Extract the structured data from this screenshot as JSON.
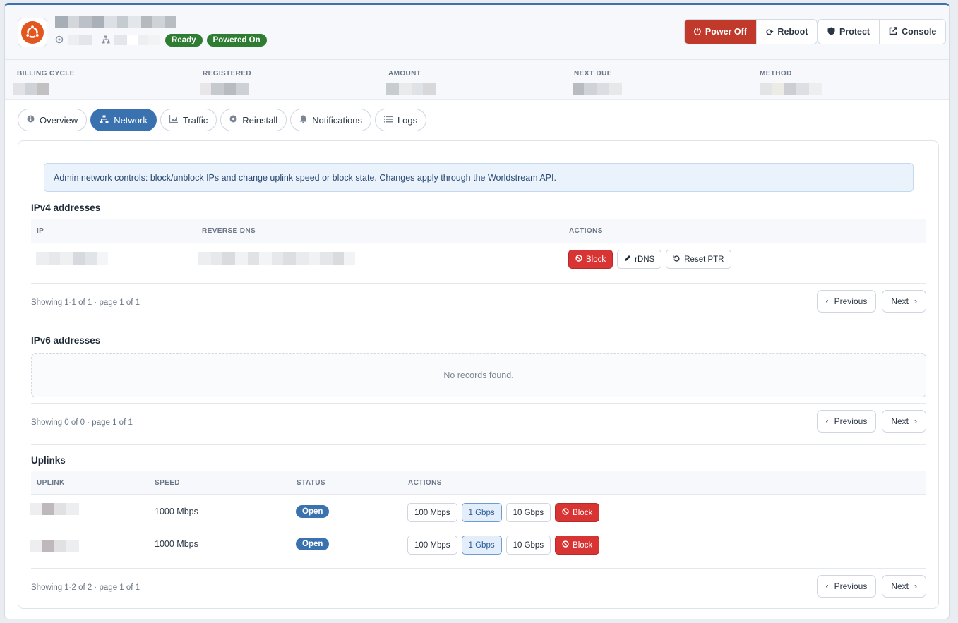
{
  "header": {
    "status_badges": [
      "Ready",
      "Powered On"
    ],
    "buttons": {
      "power_off": "Power Off",
      "reboot": "Reboot",
      "protect": "Protect",
      "console": "Console"
    },
    "os_icon": "ubuntu-logo"
  },
  "billing": {
    "labels": [
      "BILLING CYCLE",
      "REGISTERED",
      "AMOUNT",
      "NEXT DUE",
      "METHOD"
    ]
  },
  "tabs": [
    {
      "label": "Overview",
      "icon": "info-icon"
    },
    {
      "label": "Network",
      "icon": "network-icon",
      "active": true
    },
    {
      "label": "Traffic",
      "icon": "chart-icon"
    },
    {
      "label": "Reinstall",
      "icon": "disc-icon"
    },
    {
      "label": "Notifications",
      "icon": "bell-icon"
    },
    {
      "label": "Logs",
      "icon": "list-icon"
    }
  ],
  "network": {
    "info": "Admin network controls: block/unblock IPs and change uplink speed or block state. Changes apply through the Worldstream API.",
    "ipv4": {
      "title": "IPv4 addresses",
      "columns": [
        "IP",
        "REVERSE DNS",
        "ACTIONS"
      ],
      "actions": [
        "Block",
        "rDNS",
        "Reset PTR"
      ],
      "pagination": "Showing 1-1 of 1 · page 1 of 1"
    },
    "ipv6": {
      "title": "IPv6 addresses",
      "empty": "No records found.",
      "pagination": "Showing 0 of 0 · page 1 of 1"
    },
    "uplinks": {
      "title": "Uplinks",
      "columns": [
        "UPLINK",
        "SPEED",
        "STATUS",
        "ACTIONS"
      ],
      "rows": [
        {
          "speed": "1000 Mbps",
          "status": "Open"
        },
        {
          "speed": "1000 Mbps",
          "status": "Open"
        }
      ],
      "speed_options": [
        "100 Mbps",
        "1 Gbps",
        "10 Gbps"
      ],
      "selected_speed": "1 Gbps",
      "block_label": "Block",
      "pagination": "Showing 1-2 of 2 · page 1 of 1"
    },
    "pager": {
      "previous": "Previous",
      "next": "Next"
    }
  },
  "colors": {
    "accent": "#3a72b0",
    "danger": "#d93434",
    "success": "#2e7d32"
  }
}
